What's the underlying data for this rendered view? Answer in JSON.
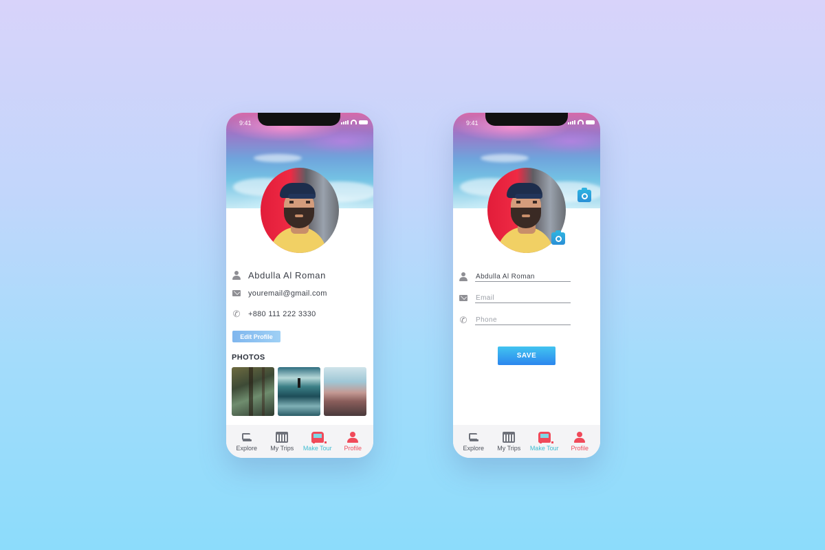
{
  "status": {
    "time": "9:41"
  },
  "profile": {
    "name": "Abdulla Al Roman",
    "email": "youremail@gmail.com",
    "phone": "+880 111 222 3330",
    "edit_label": "Edit Profile",
    "photos_title": "PHOTOS",
    "photos": [
      "forest",
      "lake",
      "city"
    ]
  },
  "edit": {
    "name_value": "Abdulla Al Roman",
    "email_placeholder": "Email",
    "phone_placeholder": "Phone",
    "save_label": "SAVE"
  },
  "tabs": [
    {
      "label": "Explore",
      "icon": "explore-icon"
    },
    {
      "label": "My Trips",
      "icon": "calendar-icon"
    },
    {
      "label": "Make Tour",
      "icon": "bus-icon"
    },
    {
      "label": "Profile",
      "icon": "user-icon"
    }
  ],
  "colors": {
    "accent": "#2b86ee",
    "active_tab": "#f04a5a",
    "make_tour": "#3dbbd0"
  }
}
